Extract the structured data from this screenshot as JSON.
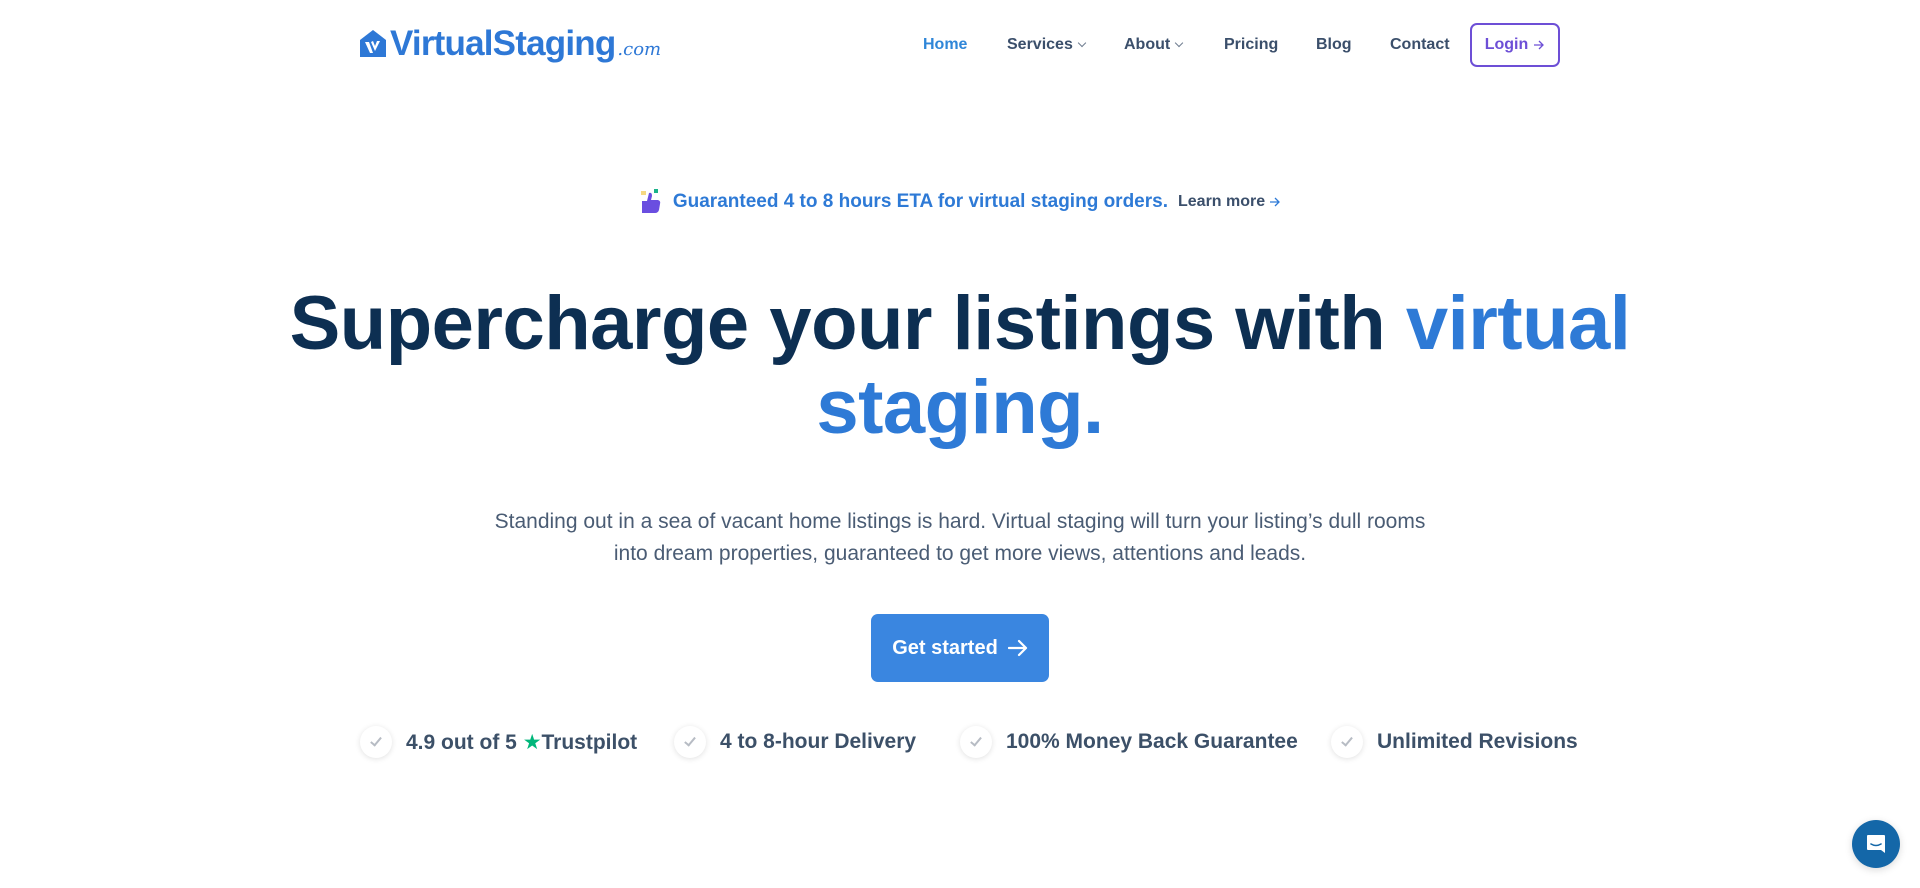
{
  "header": {
    "logo_text": "VirtualStaging",
    "logo_suffix": ".com",
    "nav": [
      {
        "label": "Home",
        "active": true,
        "dropdown": false
      },
      {
        "label": "Services",
        "active": false,
        "dropdown": true
      },
      {
        "label": "About",
        "active": false,
        "dropdown": true
      },
      {
        "label": "Pricing",
        "active": false,
        "dropdown": false
      },
      {
        "label": "Blog",
        "active": false,
        "dropdown": false
      },
      {
        "label": "Contact",
        "active": false,
        "dropdown": false
      }
    ],
    "login_label": "Login",
    "login_icon": "arrow-right-icon"
  },
  "announcement": {
    "icon": "thumbs-up-icon",
    "text": "Guaranteed 4 to 8 hours ETA for virtual staging orders.",
    "link_label": "Learn more",
    "link_icon": "arrow-right-icon"
  },
  "hero": {
    "title_part1": "Supercharge your listings with ",
    "title_accent1": "virtual",
    "title_accent2": "staging.",
    "subtitle": "Standing out in a sea of vacant home listings is hard. Virtual staging will turn your listing’s dull rooms into dream properties, guaranteed to get more views, attentions and leads.",
    "cta_label": "Get started",
    "cta_icon": "arrow-right-icon"
  },
  "features": [
    {
      "text_before": "4.9 out of 5 ",
      "star": "★",
      "text_after": "Trustpilot",
      "icon": "check-icon"
    },
    {
      "text_before": "4 to 8-hour Delivery",
      "icon": "check-icon"
    },
    {
      "text_before": "100% Money Back Guarantee",
      "icon": "check-icon"
    },
    {
      "text_before": "Unlimited Revisions",
      "icon": "check-icon"
    }
  ],
  "colors": {
    "brand_blue": "#2e7ad6",
    "navy": "#0d2f52",
    "login_purple": "#6d4fd6",
    "cta_blue": "#3a86e0",
    "trustpilot_green": "#00b67a",
    "chat_blue": "#1467a8"
  },
  "chat_widget": {
    "icon": "chat-bubble-icon"
  }
}
